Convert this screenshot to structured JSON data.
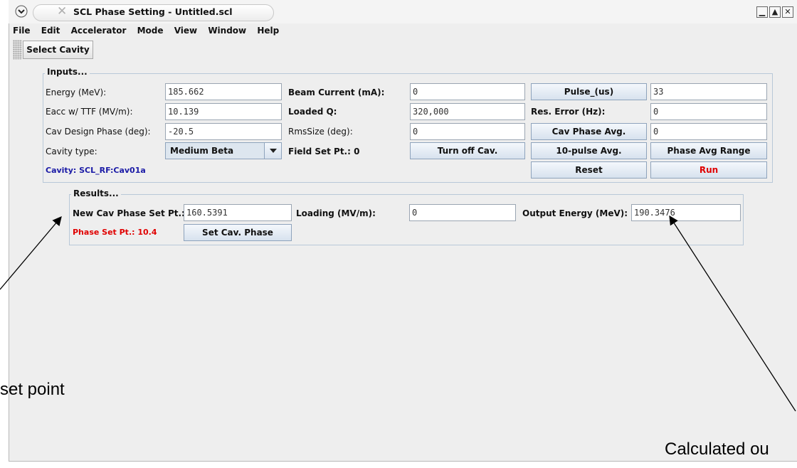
{
  "window": {
    "title": "SCL Phase Setting - Untitled.scl",
    "controls": {
      "minimize_glyph": "▁",
      "maximize_glyph": "▲",
      "close_glyph": "✕"
    }
  },
  "menu": [
    "File",
    "Edit",
    "Accelerator",
    "Mode",
    "View",
    "Window",
    "Help"
  ],
  "toolbar": {
    "select_cavity": "Select Cavity"
  },
  "inputs": {
    "legend": "Inputs...",
    "energy_label": "Energy (MeV):",
    "energy_value": "185.662",
    "eacc_label": "Eacc w/ TTF (MV/m):",
    "eacc_value": "10.139",
    "design_phase_label": "Cav Design Phase (deg):",
    "design_phase_value": "-20.5",
    "cavity_type_label": "Cavity type:",
    "cavity_type_value": "Medium Beta",
    "cavity_name": "Cavity: SCL_RF:Cav01a",
    "beam_current_label": "Beam Current (mA):",
    "beam_current_value": "0",
    "loaded_q_label": "Loaded Q:",
    "loaded_q_value": "320,000",
    "rms_size_label": "RmsSize (deg):",
    "rms_size_value": "0",
    "field_set_pt": "Field Set Pt.: 0",
    "turn_off_cav": "Turn off Cav.",
    "pulse_button": "Pulse_(us)",
    "pulse_value": "33",
    "res_error_label": "Res. Error (Hz):",
    "res_error_value": "0",
    "cav_phase_avg_button": "Cav Phase Avg.",
    "cav_phase_avg_value": "0",
    "ten_pulse_avg": "10-pulse Avg.",
    "phase_avg_range": "Phase Avg Range",
    "reset": "Reset",
    "run": "Run"
  },
  "results": {
    "legend": "Results...",
    "new_phase_label": "New Cav Phase Set Pt.:",
    "new_phase_value": "160.5391",
    "loading_label": "Loading (MV/m):",
    "loading_value": "0",
    "output_energy_label": "Output Energy (MeV):",
    "output_energy_value": "190.3476",
    "phase_set_pt": "Phase Set Pt.: 10.4",
    "set_cav_phase": "Set Cav. Phase"
  },
  "annotations": {
    "left": "set point",
    "right": "Calculated ou"
  },
  "colors": {
    "run_text": "#e00000",
    "cavity_name_text": "#1a1aa6",
    "phase_set_text": "#e00000",
    "button_border": "#8ea3bc",
    "panel_border": "#b8c8d8"
  }
}
